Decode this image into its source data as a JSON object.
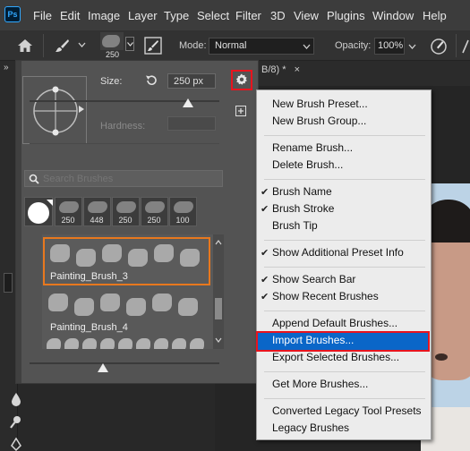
{
  "menubar": {
    "logo": "Ps",
    "items": [
      "File",
      "Edit",
      "Image",
      "Layer",
      "Type",
      "Select",
      "Filter",
      "3D",
      "View",
      "Plugins",
      "Window",
      "Help"
    ]
  },
  "options_bar": {
    "brush_size": "250",
    "mode_label": "Mode:",
    "mode_value": "Normal",
    "opacity_label": "Opacity:",
    "opacity_value": "100%"
  },
  "document": {
    "tab_title": "B/8) *",
    "close_glyph": "×"
  },
  "brush_panel": {
    "collapse_glyph": "»",
    "size_label": "Size:",
    "size_value": "250 px",
    "hardness_label": "Hardness:",
    "search_placeholder": "Search Brushes",
    "recent_brushes": [
      "250",
      "448",
      "250",
      "250",
      "100"
    ],
    "brush_list": [
      {
        "name": "Painting_Brush_3",
        "selected": true
      },
      {
        "name": "Painting_Brush_4",
        "selected": false
      }
    ]
  },
  "context_menu": {
    "highlighted": "Import Brushes...",
    "groups": [
      {
        "items": [
          {
            "label": "New Brush Preset...",
            "checked": false
          },
          {
            "label": "New Brush Group...",
            "checked": false
          }
        ]
      },
      {
        "items": [
          {
            "label": "Rename Brush...",
            "checked": false
          },
          {
            "label": "Delete Brush...",
            "checked": false
          }
        ]
      },
      {
        "items": [
          {
            "label": "Brush Name",
            "checked": true
          },
          {
            "label": "Brush Stroke",
            "checked": true
          },
          {
            "label": "Brush Tip",
            "checked": false
          }
        ]
      },
      {
        "items": [
          {
            "label": "Show Additional Preset Info",
            "checked": true
          }
        ]
      },
      {
        "items": [
          {
            "label": "Show Search Bar",
            "checked": true
          },
          {
            "label": "Show Recent Brushes",
            "checked": true
          }
        ]
      },
      {
        "items": [
          {
            "label": "Append Default Brushes...",
            "checked": false
          },
          {
            "label": "Import Brushes...",
            "checked": false
          },
          {
            "label": "Export Selected Brushes...",
            "checked": false
          }
        ]
      },
      {
        "items": [
          {
            "label": "Get More Brushes...",
            "checked": false
          }
        ]
      },
      {
        "items": [
          {
            "label": "Converted Legacy Tool Presets",
            "checked": false
          },
          {
            "label": "Legacy Brushes",
            "checked": false
          }
        ]
      }
    ]
  },
  "colors": {
    "menubar_bg": "#3c3c3c",
    "panel_bg": "#535353",
    "menu_bg": "#ececec",
    "highlight_bg": "#0a66c8",
    "highlight_outline": "#e8141e",
    "selected_brush_outline": "#e8781e",
    "ps_blue": "#31a8ff"
  },
  "icons": {
    "home": "home-icon",
    "brush_tool": "brush-icon",
    "brush_settings": "brush-settings-icon",
    "gear": "gear-icon",
    "reset_size": "reset-icon",
    "new_preset": "plus-box-icon",
    "search": "search-icon",
    "pressure": "pressure-icon",
    "collapse": "collapse-icon"
  }
}
